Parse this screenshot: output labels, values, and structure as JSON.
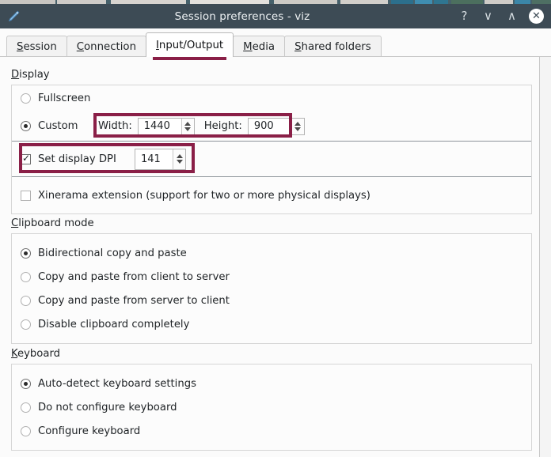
{
  "window": {
    "title": "Session preferences - viz",
    "icon": "pencil-icon",
    "titlebar_color": "#3d4b55",
    "controls": [
      {
        "name": "help-button",
        "glyph": "?"
      },
      {
        "name": "minimize-button",
        "glyph": "∨"
      },
      {
        "name": "maximize-button",
        "glyph": "∧"
      },
      {
        "name": "close-button",
        "glyph": "✕"
      }
    ]
  },
  "accent_color": "#8a1f47",
  "tabs": [
    {
      "pre": "",
      "key": "S",
      "post": "ession",
      "active": false,
      "name": "tab-session"
    },
    {
      "pre": "",
      "key": "C",
      "post": "onnection",
      "active": false,
      "name": "tab-connection"
    },
    {
      "pre": "",
      "key": "I",
      "post": "nput/Output",
      "active": true,
      "name": "tab-input-output"
    },
    {
      "pre": "",
      "key": "M",
      "post": "edia",
      "active": false,
      "name": "tab-media"
    },
    {
      "pre": "",
      "key": "S",
      "post": "hared folders",
      "active": false,
      "name": "tab-shared-folders"
    }
  ],
  "display": {
    "title_key": "D",
    "title_rest": "isplay",
    "fullscreen": {
      "label": "Fullscreen",
      "selected": false
    },
    "custom": {
      "label": "Custom",
      "selected": true
    },
    "width": {
      "label": "Width:",
      "value": "1440"
    },
    "height": {
      "label": "Height:",
      "value": "900"
    },
    "dpi": {
      "label": "Set display DPI",
      "checked": true,
      "value": "141"
    },
    "xinerama": {
      "label": "Xinerama extension (support for two or more physical displays)",
      "checked": false
    }
  },
  "clipboard": {
    "title_key": "C",
    "title_rest": "lipboard mode",
    "options": [
      {
        "label": "Bidirectional copy and paste",
        "selected": true
      },
      {
        "label": "Copy and paste from client to server",
        "selected": false
      },
      {
        "label": "Copy and paste from server to client",
        "selected": false
      },
      {
        "label": "Disable clipboard completely",
        "selected": false
      }
    ]
  },
  "keyboard": {
    "title_key": "K",
    "title_rest": "eyboard",
    "options": [
      {
        "label": "Auto-detect keyboard settings",
        "selected": true
      },
      {
        "label": "Do not configure keyboard",
        "selected": false
      },
      {
        "label": "Configure keyboard",
        "selected": false
      }
    ]
  }
}
